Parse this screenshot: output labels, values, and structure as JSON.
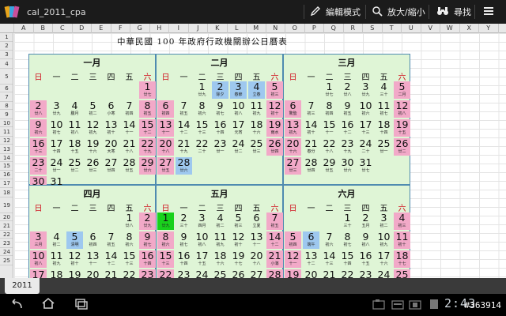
{
  "app": {
    "title": "cal_2011_cpa",
    "edit_mode_label": "編輯模式",
    "zoom_label": "放大/縮小",
    "find_label": "尋找"
  },
  "sheet": {
    "columns": [
      "A",
      "B",
      "C",
      "D",
      "E",
      "F",
      "G",
      "H",
      "I",
      "J",
      "K",
      "L",
      "M",
      "N",
      "O",
      "P",
      "Q",
      "R",
      "S",
      "T",
      "U",
      "V",
      "W",
      "X",
      "Y"
    ],
    "rows": [
      "1",
      "2",
      "3",
      "4",
      "5",
      "6",
      "7",
      "8",
      "9",
      "10",
      "11",
      "12",
      "13",
      "14",
      "15",
      "16",
      "17",
      "18",
      "19",
      "20",
      "21",
      "22",
      "23",
      "24",
      "25"
    ],
    "title": "中華民國 100 年政府行政機關辦公日曆表",
    "tab_label": "2011"
  },
  "weekdays": [
    "日",
    "一",
    "二",
    "三",
    "四",
    "五",
    "六"
  ],
  "months": [
    {
      "name": "一月",
      "cells": [
        [
          "",
          "",
          ""
        ],
        [
          "",
          "",
          ""
        ],
        [
          "",
          "",
          ""
        ],
        [
          "",
          "",
          ""
        ],
        [
          "",
          "",
          ""
        ],
        [
          "",
          "",
          ""
        ],
        [
          "1",
          "廿七",
          "pink"
        ],
        [
          "2",
          "廿八",
          "pink"
        ],
        [
          "3",
          "廿九",
          ""
        ],
        [
          "4",
          "臘月",
          ""
        ],
        [
          "5",
          "初二",
          ""
        ],
        [
          "6",
          "小寒",
          ""
        ],
        [
          "7",
          "初四",
          ""
        ],
        [
          "8",
          "初五",
          "pink"
        ],
        [
          "9",
          "初六",
          "pink"
        ],
        [
          "10",
          "初七",
          ""
        ],
        [
          "11",
          "初八",
          ""
        ],
        [
          "12",
          "初九",
          ""
        ],
        [
          "13",
          "初十",
          ""
        ],
        [
          "14",
          "十一",
          ""
        ],
        [
          "15",
          "十二",
          "pink"
        ],
        [
          "16",
          "十三",
          "pink"
        ],
        [
          "17",
          "十四",
          ""
        ],
        [
          "18",
          "十五",
          ""
        ],
        [
          "19",
          "十六",
          ""
        ],
        [
          "20",
          "大寒",
          ""
        ],
        [
          "21",
          "十八",
          ""
        ],
        [
          "22",
          "十九",
          "pink"
        ],
        [
          "23",
          "二十",
          "pink"
        ],
        [
          "24",
          "廿一",
          ""
        ],
        [
          "25",
          "廿二",
          ""
        ],
        [
          "26",
          "廿三",
          ""
        ],
        [
          "27",
          "廿四",
          ""
        ],
        [
          "28",
          "廿五",
          ""
        ],
        [
          "29",
          "廿六",
          "pink"
        ],
        [
          "30",
          "廿七",
          "pink"
        ],
        [
          "31",
          "廿八",
          ""
        ]
      ]
    },
    {
      "name": "二月",
      "cells": [
        [
          "",
          "",
          ""
        ],
        [
          "",
          "",
          ""
        ],
        [
          "1",
          "廿九",
          ""
        ],
        [
          "2",
          "除夕",
          "blue"
        ],
        [
          "3",
          "春節",
          "blue"
        ],
        [
          "4",
          "立春",
          "blue"
        ],
        [
          "5",
          "初三",
          "pink"
        ],
        [
          "6",
          "初四",
          "pink"
        ],
        [
          "7",
          "初五",
          ""
        ],
        [
          "8",
          "初六",
          ""
        ],
        [
          "9",
          "初七",
          ""
        ],
        [
          "10",
          "初八",
          ""
        ],
        [
          "11",
          "初九",
          ""
        ],
        [
          "12",
          "初十",
          "pink"
        ],
        [
          "13",
          "十一",
          "pink"
        ],
        [
          "14",
          "十二",
          ""
        ],
        [
          "15",
          "十三",
          ""
        ],
        [
          "16",
          "十四",
          ""
        ],
        [
          "17",
          "元宵",
          ""
        ],
        [
          "18",
          "十六",
          ""
        ],
        [
          "19",
          "雨水",
          "pink"
        ],
        [
          "20",
          "十八",
          "pink"
        ],
        [
          "21",
          "十九",
          ""
        ],
        [
          "22",
          "二十",
          ""
        ],
        [
          "23",
          "廿一",
          ""
        ],
        [
          "24",
          "廿二",
          ""
        ],
        [
          "25",
          "廿三",
          ""
        ],
        [
          "26",
          "廿四",
          "pink"
        ],
        [
          "27",
          "廿五",
          "pink"
        ],
        [
          "28",
          "廿六",
          "blue"
        ]
      ]
    },
    {
      "name": "三月",
      "cells": [
        [
          "",
          "",
          ""
        ],
        [
          "",
          "",
          ""
        ],
        [
          "1",
          "廿七",
          ""
        ],
        [
          "2",
          "廿八",
          ""
        ],
        [
          "3",
          "廿九",
          ""
        ],
        [
          "4",
          "三十",
          ""
        ],
        [
          "5",
          "二月",
          "pink"
        ],
        [
          "6",
          "驚蟄",
          "pink"
        ],
        [
          "7",
          "初三",
          ""
        ],
        [
          "8",
          "初四",
          ""
        ],
        [
          "9",
          "初五",
          ""
        ],
        [
          "10",
          "初六",
          ""
        ],
        [
          "11",
          "初七",
          ""
        ],
        [
          "12",
          "初八",
          "pink"
        ],
        [
          "13",
          "初九",
          "pink"
        ],
        [
          "14",
          "初十",
          ""
        ],
        [
          "15",
          "十一",
          ""
        ],
        [
          "16",
          "十二",
          ""
        ],
        [
          "17",
          "十三",
          ""
        ],
        [
          "18",
          "十四",
          ""
        ],
        [
          "19",
          "十五",
          "pink"
        ],
        [
          "20",
          "十六",
          "pink"
        ],
        [
          "21",
          "春分",
          ""
        ],
        [
          "22",
          "十八",
          ""
        ],
        [
          "23",
          "十九",
          ""
        ],
        [
          "24",
          "二十",
          ""
        ],
        [
          "25",
          "廿一",
          ""
        ],
        [
          "26",
          "廿二",
          "pink"
        ],
        [
          "27",
          "廿三",
          "pink"
        ],
        [
          "28",
          "廿四",
          ""
        ],
        [
          "29",
          "廿五",
          ""
        ],
        [
          "30",
          "廿六",
          ""
        ],
        [
          "31",
          "廿七",
          ""
        ]
      ]
    },
    {
      "name": "四月",
      "cells": [
        [
          "",
          "",
          ""
        ],
        [
          "",
          "",
          ""
        ],
        [
          "",
          "",
          ""
        ],
        [
          "",
          "",
          ""
        ],
        [
          "",
          "",
          ""
        ],
        [
          "1",
          "廿八",
          ""
        ],
        [
          "2",
          "廿九",
          "pink"
        ],
        [
          "3",
          "三月",
          "pink"
        ],
        [
          "4",
          "初二",
          ""
        ],
        [
          "5",
          "清明",
          "blue"
        ],
        [
          "6",
          "初四",
          ""
        ],
        [
          "7",
          "初五",
          ""
        ],
        [
          "8",
          "初六",
          ""
        ],
        [
          "9",
          "初七",
          "pink"
        ],
        [
          "10",
          "初八",
          "pink"
        ],
        [
          "11",
          "初九",
          ""
        ],
        [
          "12",
          "初十",
          ""
        ],
        [
          "13",
          "十一",
          ""
        ],
        [
          "14",
          "十二",
          ""
        ],
        [
          "15",
          "十三",
          ""
        ],
        [
          "16",
          "十四",
          "pink"
        ],
        [
          "17",
          "十五",
          "pink"
        ],
        [
          "18",
          "十六",
          ""
        ],
        [
          "19",
          "十七",
          ""
        ],
        [
          "20",
          "穀雨",
          ""
        ],
        [
          "21",
          "十九",
          ""
        ],
        [
          "22",
          "二十",
          ""
        ],
        [
          "23",
          "廿一",
          "pink"
        ]
      ]
    },
    {
      "name": "五月",
      "cells": [
        [
          "1",
          "廿九",
          "green"
        ],
        [
          "2",
          "三十",
          ""
        ],
        [
          "3",
          "四月",
          ""
        ],
        [
          "4",
          "初二",
          ""
        ],
        [
          "5",
          "初三",
          ""
        ],
        [
          "6",
          "立夏",
          ""
        ],
        [
          "7",
          "初五",
          "pink"
        ],
        [
          "8",
          "初六",
          "pink"
        ],
        [
          "9",
          "初七",
          ""
        ],
        [
          "10",
          "初八",
          ""
        ],
        [
          "11",
          "初九",
          ""
        ],
        [
          "12",
          "初十",
          ""
        ],
        [
          "13",
          "十一",
          ""
        ],
        [
          "14",
          "十二",
          "pink"
        ],
        [
          "15",
          "十三",
          "pink"
        ],
        [
          "16",
          "十四",
          ""
        ],
        [
          "17",
          "十五",
          ""
        ],
        [
          "18",
          "十六",
          ""
        ],
        [
          "19",
          "十七",
          ""
        ],
        [
          "20",
          "十八",
          ""
        ],
        [
          "21",
          "小滿",
          "pink"
        ],
        [
          "22",
          "二十",
          "pink"
        ],
        [
          "23",
          "廿一",
          ""
        ],
        [
          "24",
          "廿二",
          ""
        ],
        [
          "25",
          "廿三",
          ""
        ],
        [
          "26",
          "廿四",
          ""
        ],
        [
          "27",
          "廿五",
          ""
        ],
        [
          "28",
          "廿六",
          "pink"
        ]
      ]
    },
    {
      "name": "六月",
      "cells": [
        [
          "",
          "",
          ""
        ],
        [
          "",
          "",
          ""
        ],
        [
          "",
          "",
          ""
        ],
        [
          "1",
          "三十",
          ""
        ],
        [
          "2",
          "五月",
          ""
        ],
        [
          "3",
          "初二",
          ""
        ],
        [
          "4",
          "初三",
          "pink"
        ],
        [
          "5",
          "初四",
          "pink"
        ],
        [
          "6",
          "端午",
          "blue"
        ],
        [
          "7",
          "初六",
          ""
        ],
        [
          "8",
          "初七",
          ""
        ],
        [
          "9",
          "初八",
          ""
        ],
        [
          "10",
          "初九",
          ""
        ],
        [
          "11",
          "初十",
          "pink"
        ],
        [
          "12",
          "十一",
          "pink"
        ],
        [
          "13",
          "十二",
          ""
        ],
        [
          "14",
          "十三",
          ""
        ],
        [
          "15",
          "十四",
          ""
        ],
        [
          "16",
          "十五",
          ""
        ],
        [
          "17",
          "十六",
          ""
        ],
        [
          "18",
          "十七",
          "pink"
        ],
        [
          "19",
          "十八",
          "pink"
        ],
        [
          "20",
          "十九",
          ""
        ],
        [
          "21",
          "夏至",
          ""
        ],
        [
          "22",
          "廿一",
          ""
        ],
        [
          "23",
          "廿二",
          ""
        ],
        [
          "24",
          "廿三",
          ""
        ],
        [
          "25",
          "廿四",
          "pink"
        ]
      ]
    }
  ],
  "status": {
    "clock": "2:43",
    "watermark": "#363914"
  }
}
